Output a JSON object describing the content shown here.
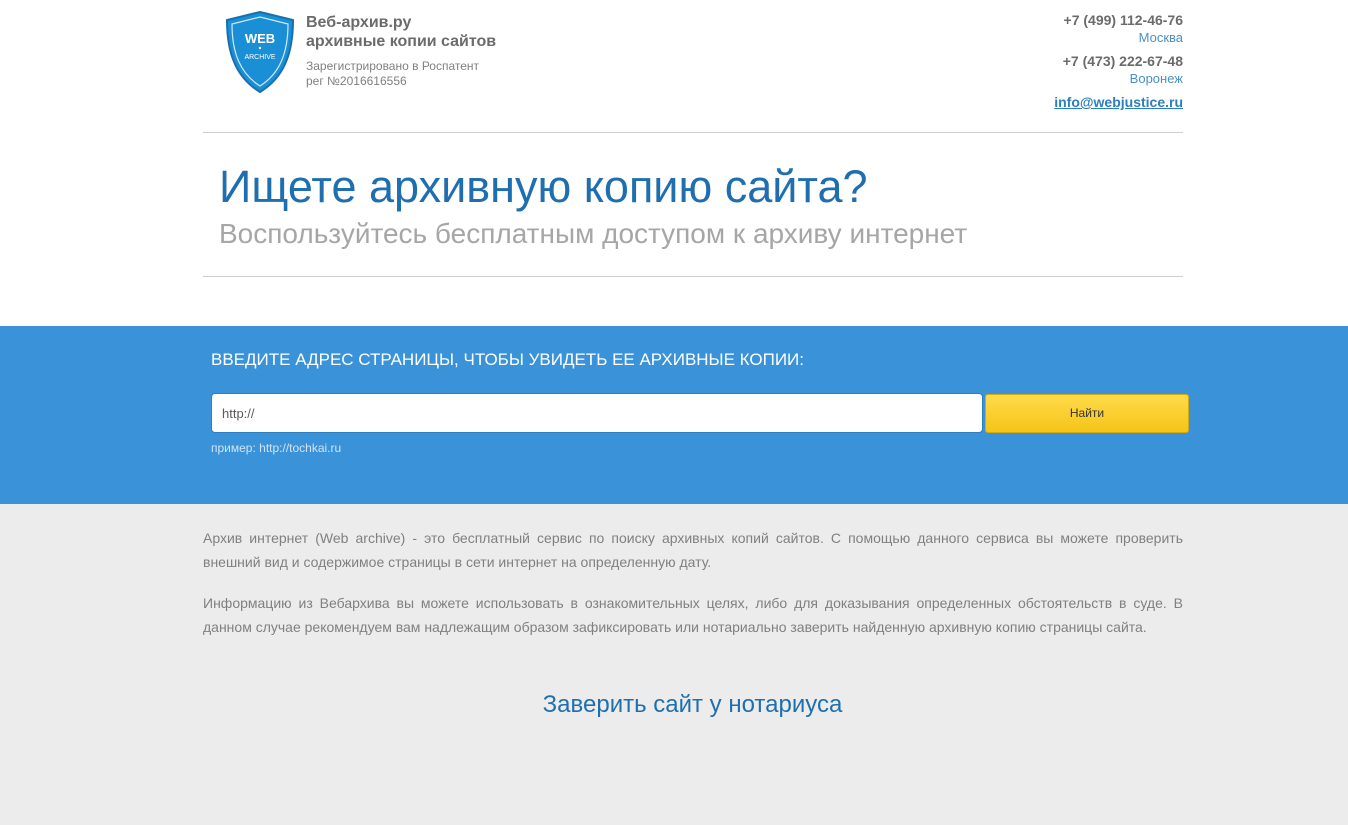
{
  "header": {
    "logo_text_top": "WEB",
    "logo_text_bottom": "ARCHIVE",
    "brand_line1": "Веб-архив.ру",
    "brand_line2": "архивные копии сайтов",
    "reg_line1": "Зарегистрировано в Роспатент",
    "reg_line2": "рег №2016616556",
    "contacts": [
      {
        "phone": "+7 (499) 112-46-76",
        "city": "Москва"
      },
      {
        "phone": "+7 (473) 222-67-48",
        "city": "Воронеж"
      }
    ],
    "email": "info@webjustice.ru"
  },
  "hero": {
    "title": "Ищете архивную копию сайта?",
    "subtitle": "Воспользуйтесь бесплатным доступом к архиву интернет"
  },
  "search": {
    "title": "ВВЕДИТЕ АДРЕС СТРАНИЦЫ, ЧТОБЫ УВИДЕТЬ ЕЕ АРХИВНЫЕ КОПИИ:",
    "input_value": "http://",
    "button_label": "Найти",
    "hint": "пример: http://tochkai.ru"
  },
  "info": {
    "paragraph1": "Архив интернет (Web archive) - это бесплатный сервис по поиску архивных копий сайтов. С помощью данного сервиса вы можете проверить внешний вид и содержимое страницы в сети интернет на определенную дату.",
    "paragraph2": "Информацию из Вебархива вы можете использовать в ознакомительных целях, либо для доказывания определенных обстоятельств в суде. В данном случае рекомендуем вам надлежащим образом зафиксировать или нотариально заверить найденную архивную копию страницы сайта.",
    "notary_link": "Заверить сайт у нотариуса"
  },
  "colors": {
    "accent": "#3a93d8",
    "title_blue": "#1f6fb0",
    "button_yellow": "#f5c417",
    "info_bg": "#ececec"
  }
}
